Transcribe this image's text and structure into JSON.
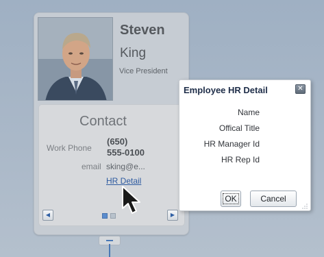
{
  "person": {
    "first_name": "Steven",
    "last_name": "King",
    "job_title": "Vice President"
  },
  "contact": {
    "heading": "Contact",
    "work_phone_label": "Work Phone",
    "work_phone_line1": "(650)",
    "work_phone_line2": "555-0100",
    "email_label": "email",
    "email_value": "sking@e...",
    "hr_detail_link": "HR Detail"
  },
  "popup": {
    "title": "Employee HR Detail",
    "close_symbol": "✕",
    "fields": [
      "Name",
      "Offical Title",
      "HR Manager Id",
      "HR Rep Id"
    ],
    "ok_label": "OK",
    "cancel_label": "Cancel"
  },
  "nav": {
    "prev_symbol": "◀",
    "next_symbol": "▶",
    "current_page": 1,
    "page_count": 2
  },
  "colors": {
    "link": "#2d5aa0",
    "accent": "#4a78b5"
  }
}
